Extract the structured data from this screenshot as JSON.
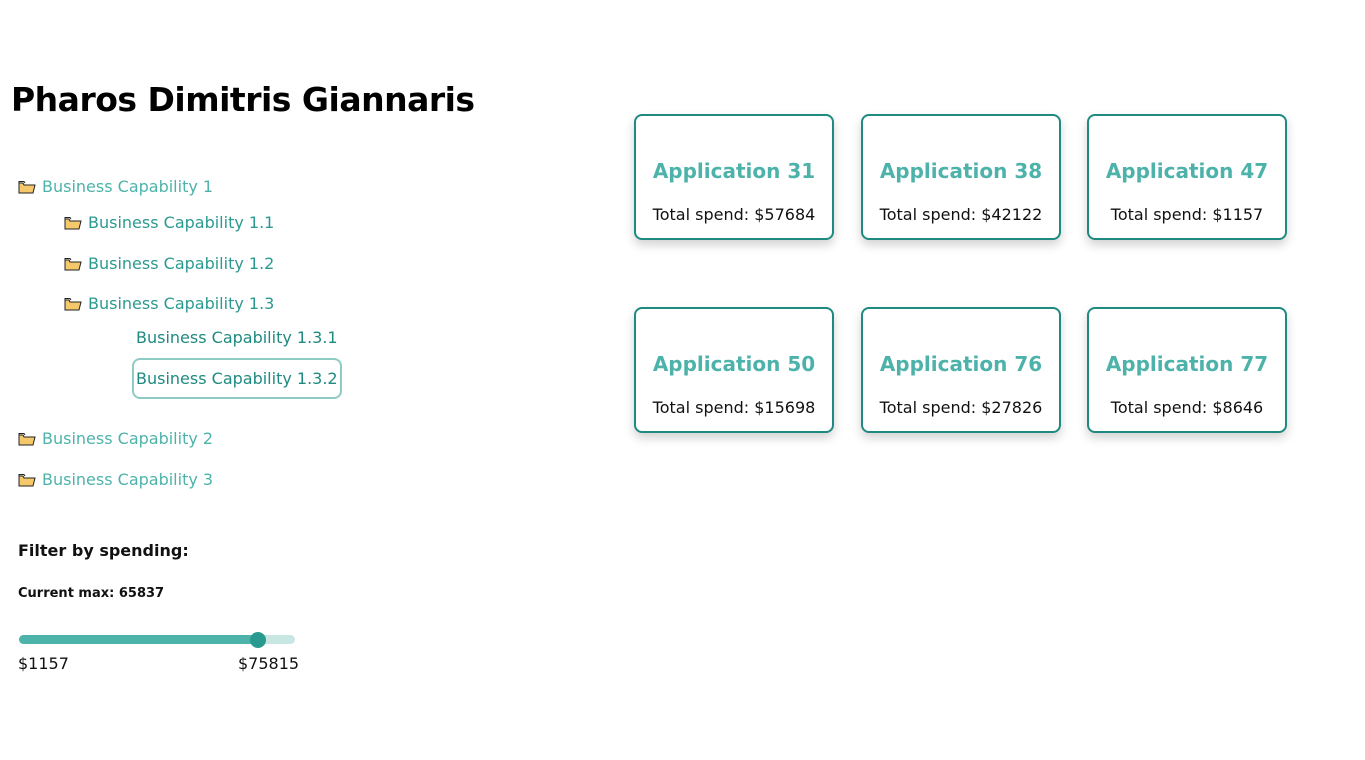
{
  "page": {
    "title": "Pharos Dimitris Giannaris"
  },
  "tree": {
    "items": [
      {
        "label": "Business Capability 1",
        "level": 0,
        "icon": "folder-icon",
        "expanded": true
      },
      {
        "label": "Business Capability 1.1",
        "level": 1,
        "icon": "folder-icon"
      },
      {
        "label": "Business Capability 1.2",
        "level": 1,
        "icon": "folder-icon"
      },
      {
        "label": "Business Capability 1.3",
        "level": 1,
        "icon": "folder-icon",
        "expanded": true
      },
      {
        "label": "Business Capability 1.3.1",
        "level": 2,
        "icon": null
      },
      {
        "label": "Business Capability 1.3.2",
        "level": 2,
        "icon": null,
        "selected": true
      },
      {
        "label": "Business Capability 2",
        "level": 0,
        "icon": "folder-icon"
      },
      {
        "label": "Business Capability 3",
        "level": 0,
        "icon": "folder-icon"
      }
    ]
  },
  "filter": {
    "heading": "Filter by spending:",
    "current_max_text": "Current max: 65837",
    "min_label": "$1157",
    "max_label": "$75815",
    "min_value": 1157,
    "max_value": 75815,
    "current_max": 65837
  },
  "cards": [
    {
      "title": "Application 31",
      "spend": "Total spend: $57684"
    },
    {
      "title": "Application 38",
      "spend": "Total spend: $42122"
    },
    {
      "title": "Application 47",
      "spend": "Total spend: $1157"
    },
    {
      "title": "Application 50",
      "spend": "Total spend: $15698"
    },
    {
      "title": "Application 76",
      "spend": "Total spend: $27826"
    },
    {
      "title": "Application 77",
      "spend": "Total spend: $8646"
    }
  ],
  "colors": {
    "accent": "#4db3aa",
    "accent_dark": "#1f8a80",
    "folder": "#f5c96b"
  }
}
